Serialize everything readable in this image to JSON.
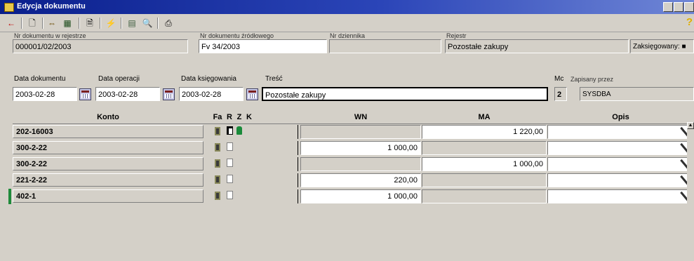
{
  "window": {
    "title": "Edycja dokumentu"
  },
  "toolbar": {
    "icons": [
      "back-arrow-icon",
      "new-document-icon",
      "transfer-icon",
      "edit-icon",
      "copy-icon",
      "filter-icon",
      "stamp-icon",
      "zoom-icon",
      "print-icon",
      "help-icon"
    ],
    "help_symbol": "?"
  },
  "header": {
    "nr_rejestr_label": "Nr dokumentu w rejestrze",
    "nr_rejestr_value": "000001/02/2003",
    "nr_zrodlowy_label": "Nr dokumentu źródłowego",
    "nr_zrodlowy_value": "Fv 34/2003",
    "nr_dziennika_label": "Nr dziennika",
    "nr_dziennika_value": "",
    "rejestr_label": "Rejestr",
    "rejestr_value": "Pozostałe zakupy",
    "zaksiegowany_label": "Zaksięgowany",
    "data_dokumentu_label": "Data dokumentu",
    "data_dokumentu_value": "2003-02-28",
    "data_operacji_label": "Data operacji",
    "data_operacji_value": "2003-02-28",
    "data_ksiegowania_label": "Data księgowania",
    "data_ksiegowania_value": "2003-02-28",
    "tresc_label": "Treść",
    "tresc_value": "Pozostałe zakupy",
    "mc_label": "Mc",
    "mc_value": "2",
    "zapisany_label": "Zapisany przez",
    "zapisany_value": "SYSDBA"
  },
  "grid": {
    "columns": {
      "konto": "Konto",
      "fa": "Fa",
      "r": "R",
      "z": "Z",
      "k": "K",
      "wn": "WN",
      "ma": "MA",
      "opis": "Opis"
    },
    "rows": [
      {
        "konto": "202-16003",
        "wn": "",
        "ma": "1 220,00",
        "opis": ""
      },
      {
        "konto": "300-2-22",
        "wn": "1 000,00",
        "ma": "",
        "opis": ""
      },
      {
        "konto": "300-2-22",
        "wn": "",
        "ma": "1 000,00",
        "opis": ""
      },
      {
        "konto": "221-2-22",
        "wn": "220,00",
        "ma": "",
        "opis": ""
      },
      {
        "konto": "402-1",
        "wn": "1 000,00",
        "ma": "",
        "opis": ""
      }
    ]
  },
  "colors": {
    "title_bar": "#0a1f8c",
    "window_bg": "#d4d0c8",
    "row_marker": "#1f8a3a"
  }
}
